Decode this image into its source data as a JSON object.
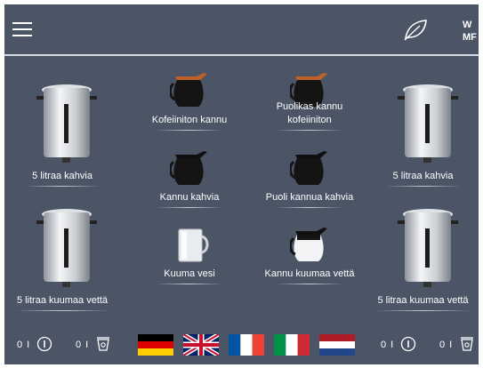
{
  "header": {
    "menu_icon": "hamburger-menu-icon",
    "eco_icon": "leaf-icon",
    "logo": "WMF"
  },
  "tiles": {
    "urn_coffee_left": {
      "label": "5 litraa kahvia",
      "icon": "urn-icon"
    },
    "urn_water_left": {
      "label": "5 litraa kuumaa vettä",
      "icon": "urn-icon"
    },
    "urn_coffee_right": {
      "label": "5 litraa kahvia",
      "icon": "urn-icon"
    },
    "urn_water_right": {
      "label": "5 litraa kuumaa vettä",
      "icon": "urn-icon"
    },
    "decaf_jug": {
      "label": "Kofeiiniton kannu",
      "icon": "coffee-jug-decaf-icon"
    },
    "half_decaf_jug": {
      "label_line1": "Puolikas kannu",
      "label_line2": "kofeiiniton",
      "icon": "coffee-jug-decaf-icon"
    },
    "coffee_jug": {
      "label": "Kannu kahvia",
      "icon": "coffee-jug-icon"
    },
    "half_coffee_jug": {
      "label": "Puoli kannua kahvia",
      "icon": "coffee-jug-icon"
    },
    "hot_water": {
      "label": "Kuuma vesi",
      "icon": "glass-icon"
    },
    "hot_water_jug": {
      "label": "Kannu kuumaa vettä",
      "icon": "water-jug-icon"
    }
  },
  "footer": {
    "counters": [
      {
        "value": "0 I",
        "icon": "info-icon"
      },
      {
        "value": "0 I",
        "icon": "cup-icon"
      },
      {
        "value": "0 I",
        "icon": "info-icon"
      },
      {
        "value": "0 I",
        "icon": "cup-icon"
      }
    ],
    "flags": [
      "german-flag",
      "uk-flag",
      "french-flag",
      "italian-flag",
      "dutch-flag"
    ]
  },
  "colors": {
    "background": "#4b5566",
    "text": "#ffffff"
  }
}
